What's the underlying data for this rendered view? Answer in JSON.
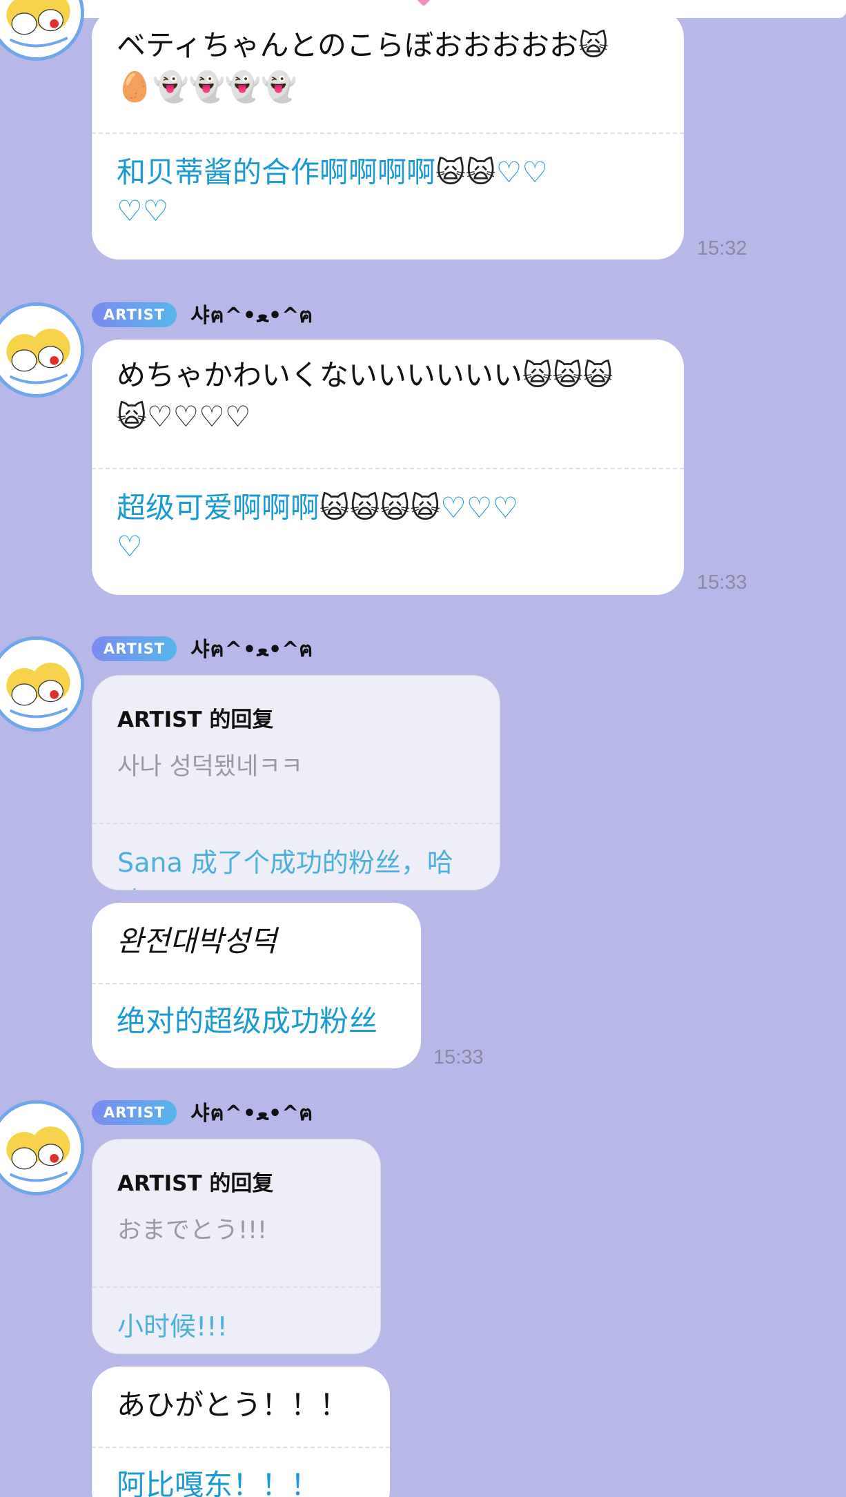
{
  "messages": [
    {
      "original": "ベティちゃんとのこらぼおおおおお🙀\n🥚👻👻👻👻",
      "translation": "和贝蒂酱的合作啊啊啊啊🙀🙀♡♡\n♡♡",
      "time": "15:32"
    },
    {
      "badge": "ARTIST",
      "sender": "샤ฅ^•ﻌ•^ฅ",
      "original": "めちゃかわいくないいいいいい🙀🙀🙀\n🙀♡♡♡♡",
      "translation": "超级可爱啊啊啊🙀🙀🙀🙀♡♡♡\n♡",
      "time": "15:33"
    },
    {
      "badge": "ARTIST",
      "sender": "샤ฅ^•ﻌ•^ฅ",
      "reply_head": "ARTIST 的回复",
      "reply_quote": "사나 성덕됐네ㅋㅋ",
      "reply_translation": "Sana 成了个成功的粉丝，哈哈"
    },
    {
      "original": "완전대박성덕",
      "translation": "绝对的超级成功粉丝",
      "time": "15:33"
    },
    {
      "badge": "ARTIST",
      "sender": "샤ฅ^•ﻌ•^ฅ",
      "reply_head": "ARTIST 的回复",
      "reply_quote": "おまでとう!!!",
      "reply_translation": "小时候!!!"
    },
    {
      "original": "あひがとう！！！",
      "translation": "阿比嘎东！！！"
    }
  ],
  "colors": {
    "background": "#b8b8e8",
    "bubble": "#ffffff",
    "reply_bubble": "#eeeef9",
    "translation": "#1a9ad2",
    "badge_start": "#7a8bf0",
    "badge_end": "#56b6ea",
    "avatar_ring": "#6fa6ec"
  },
  "icons": {
    "avatar": "cartoon-cats-avatar",
    "notch": "pink-diamond"
  }
}
